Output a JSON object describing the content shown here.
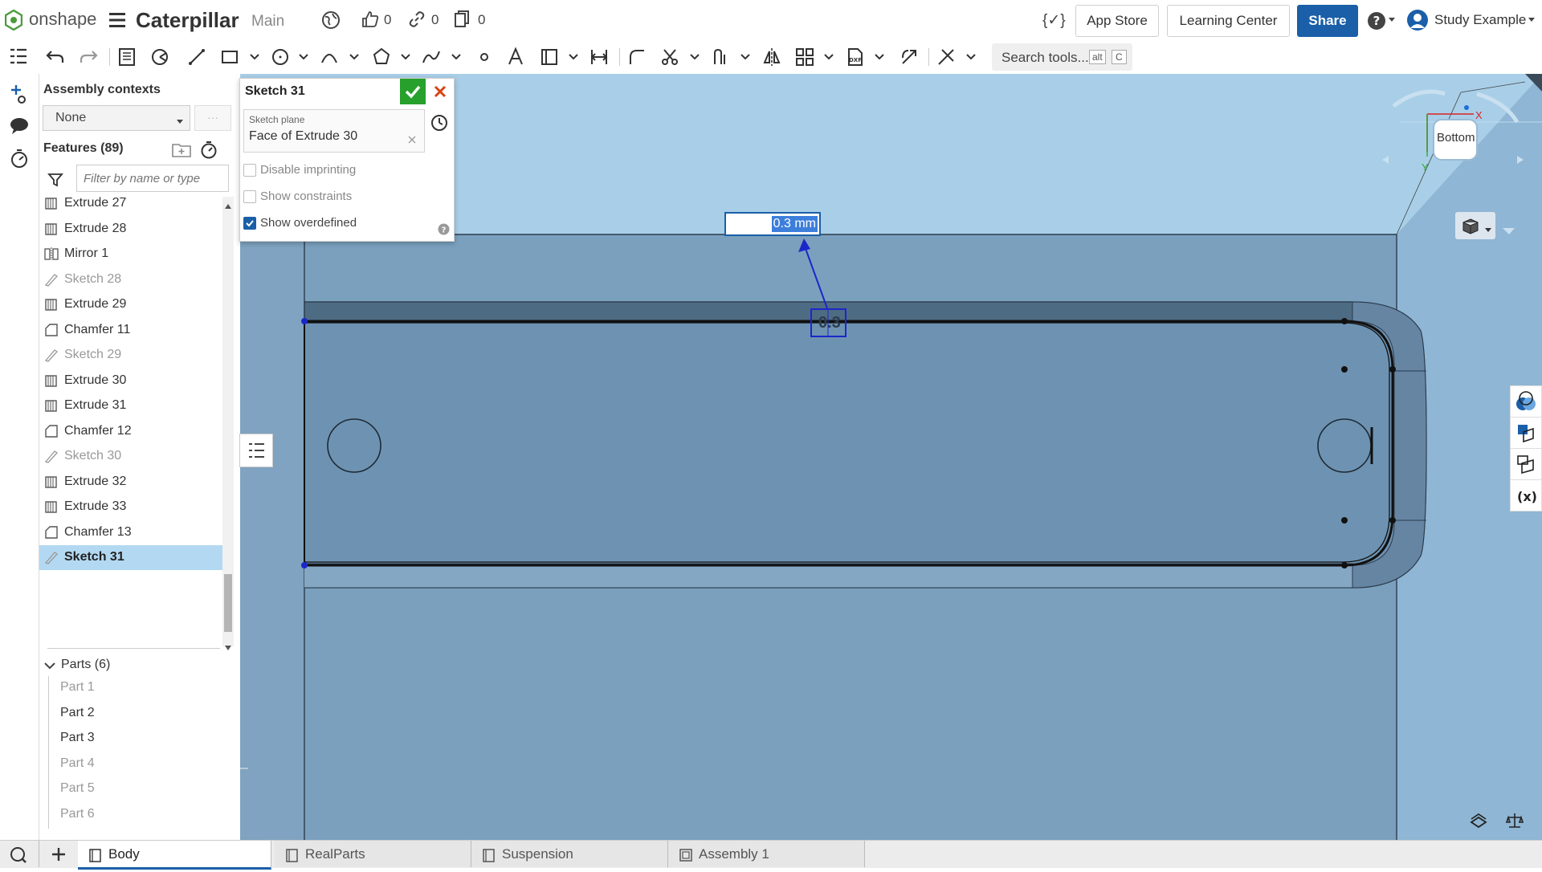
{
  "header": {
    "logo_text": "onshape",
    "doc_title": "Caterpillar",
    "branch": "Main",
    "likes": "0",
    "links": "0",
    "copies": "0",
    "app_store": "App Store",
    "learning_center": "Learning Center",
    "share": "Share",
    "user": "Study Example",
    "fx_symbol": "{✓}"
  },
  "toolbar": {
    "search_placeholder": "Search tools...",
    "shortcut_key1": "alt",
    "shortcut_key2": "C"
  },
  "feature_panel": {
    "assembly_contexts_label": "Assembly contexts",
    "assembly_context_value": "None",
    "more_dots": "···",
    "features_header": "Features (89)",
    "filter_placeholder": "Filter by name or type",
    "features": [
      {
        "label": "Extrude 27",
        "type": "extrude"
      },
      {
        "label": "Extrude 28",
        "type": "extrude"
      },
      {
        "label": "Mirror 1",
        "type": "mirror"
      },
      {
        "label": "Sketch 28",
        "type": "sketch"
      },
      {
        "label": "Extrude 29",
        "type": "extrude"
      },
      {
        "label": "Chamfer 11",
        "type": "chamfer"
      },
      {
        "label": "Sketch 29",
        "type": "sketch"
      },
      {
        "label": "Extrude 30",
        "type": "extrude"
      },
      {
        "label": "Extrude 31",
        "type": "extrude"
      },
      {
        "label": "Chamfer 12",
        "type": "chamfer"
      },
      {
        "label": "Sketch 30",
        "type": "sketch"
      },
      {
        "label": "Extrude 32",
        "type": "extrude"
      },
      {
        "label": "Extrude 33",
        "type": "extrude"
      },
      {
        "label": "Chamfer 13",
        "type": "chamfer"
      },
      {
        "label": "Sketch 31",
        "type": "sketch",
        "selected": true
      }
    ],
    "parts_header": "Parts (6)",
    "parts": [
      {
        "label": "Part 1",
        "dim": true
      },
      {
        "label": "Part 2",
        "dim": false
      },
      {
        "label": "Part 3",
        "dim": false
      },
      {
        "label": "Part 4",
        "dim": true
      },
      {
        "label": "Part 5",
        "dim": true
      },
      {
        "label": "Part 6",
        "dim": true
      }
    ]
  },
  "sketch_dialog": {
    "title": "Sketch 31",
    "plane_label": "Sketch plane",
    "plane_value": "Face of Extrude 30",
    "options": [
      {
        "label": "Disable imprinting",
        "checked": false
      },
      {
        "label": "Show constraints",
        "checked": false
      },
      {
        "label": "Show overdefined",
        "checked": true
      }
    ]
  },
  "viewport": {
    "dimension_input": "0.3 mm",
    "dimension_label": "0.3",
    "view_cube_label": "Bottom",
    "axis_x": "X",
    "axis_y": "Y"
  },
  "tabs": [
    {
      "label": "Body",
      "active": true
    },
    {
      "label": "RealParts",
      "active": false
    },
    {
      "label": "Suspension",
      "active": false
    },
    {
      "label": "Assembly 1",
      "active": false
    }
  ],
  "colors": {
    "accent_blue": "#1a5fa8",
    "brand_green": "#4b9b3c",
    "confirm_green": "#27a02c",
    "cancel_red": "#d84315",
    "selection_blue": "#b3d9f2",
    "viewport_blue": "#7fa3c0",
    "sky_blue": "#a9cfe8",
    "sketch_blue": "#1b27c9"
  }
}
